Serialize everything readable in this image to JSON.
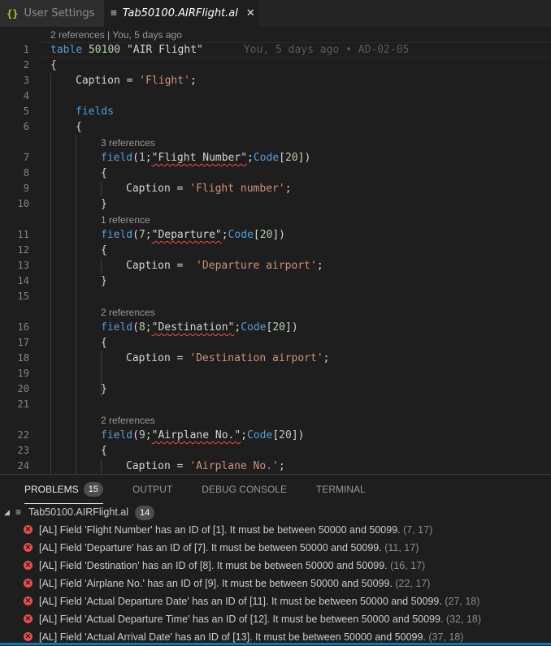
{
  "tabs": [
    {
      "icon": "{}",
      "label": "User Settings",
      "active": false
    },
    {
      "icon": "≡",
      "label": "Tab50100.AIRFlight.al",
      "active": true,
      "close": "✕"
    }
  ],
  "editor": {
    "top_lens": "2 references | You, 5 days ago",
    "blame": "You, 5 days ago • AD-02-05",
    "lines": {
      "l1": "table",
      "l1b": "50100",
      "l1c": "\"AIR Flight\"",
      "l2": "{",
      "l3a": "Caption = ",
      "l3b": "'Flight'",
      "l3c": ";",
      "l5": "fields",
      "l6": "{",
      "lens7": "3 references",
      "l7a": "field",
      "l7b": "(",
      "l7c": "1",
      "l7d": ";",
      "l7e": "\"Flight Number\"",
      "l7f": ";",
      "l7g": "Code",
      "l7h": "[",
      "l7i": "20",
      "l7j": "])",
      "l8": "{",
      "l9a": "Caption = ",
      "l9b": "'Flight number'",
      "l9c": ";",
      "l10": "}",
      "lens11": "1 reference",
      "l11a": "field",
      "l11b": "(",
      "l11c": "7",
      "l11d": ";",
      "l11e": "\"Departure\"",
      "l11f": ";",
      "l11g": "Code",
      "l11h": "[",
      "l11i": "20",
      "l11j": "])",
      "l12": "{",
      "l13a": "Caption =  ",
      "l13b": "'Departure airport'",
      "l13c": ";",
      "l14": "}",
      "lens16": "2 references",
      "l16a": "field",
      "l16b": "(",
      "l16c": "8",
      "l16d": ";",
      "l16e": "\"Destination\"",
      "l16f": ";",
      "l16g": "Code",
      "l16h": "[",
      "l16i": "20",
      "l16j": "])",
      "l17": "{",
      "l18a": "Caption = ",
      "l18b": "'Destination airport'",
      "l18c": ";",
      "l20": "}",
      "lens22": "2 references",
      "l22a": "field",
      "l22b": "(",
      "l22c": "9",
      "l22d": ";",
      "l22e": "\"Airplane No.\"",
      "l22f": ";",
      "l22g": "Code",
      "l22h": "[",
      "l22i": "20",
      "l22j": "])",
      "l23": "{",
      "l24a": "Caption = ",
      "l24b": "'Airplane No.'",
      "l24c": ";"
    },
    "numbers": [
      "1",
      "2",
      "3",
      "4",
      "5",
      "6",
      "7",
      "8",
      "9",
      "10",
      "11",
      "12",
      "13",
      "14",
      "15",
      "16",
      "17",
      "18",
      "19",
      "20",
      "21",
      "22",
      "23",
      "24"
    ]
  },
  "panel": {
    "tabs": [
      {
        "label": "PROBLEMS",
        "badge": "15",
        "active": true
      },
      {
        "label": "OUTPUT"
      },
      {
        "label": "DEBUG CONSOLE"
      },
      {
        "label": "TERMINAL"
      }
    ],
    "file": {
      "twisty": "◢",
      "icon": "≡",
      "name": "Tab50100.AIRFlight.al",
      "count": "14"
    },
    "problems": [
      {
        "msg": "[AL] Field 'Flight Number' has an ID of [1]. It must be between 50000 and 50099.",
        "pos": "(7, 17)"
      },
      {
        "msg": "[AL] Field 'Departure' has an ID of [7]. It must be between 50000 and 50099.",
        "pos": "(11, 17)"
      },
      {
        "msg": "[AL] Field 'Destination' has an ID of [8]. It must be between 50000 and 50099.",
        "pos": "(16, 17)"
      },
      {
        "msg": "[AL] Field 'Airplane No.' has an ID of [9]. It must be between 50000 and 50099.",
        "pos": "(22, 17)"
      },
      {
        "msg": "[AL] Field 'Actual Departure Date' has an ID of [11]. It must be between 50000 and 50099.",
        "pos": "(27, 18)"
      },
      {
        "msg": "[AL] Field 'Actual Departure Time' has an ID of [12]. It must be between 50000 and 50099.",
        "pos": "(32, 18)"
      },
      {
        "msg": "[AL] Field 'Actual Arrival Date' has an ID of [13]. It must be between 50000 and 50099.",
        "pos": "(37, 18)"
      }
    ]
  },
  "colors": {
    "keyword": "#569cd6",
    "number": "#b5cea8",
    "string": "#ce9178",
    "error": "#f14c4c",
    "accent": "#007acc"
  }
}
